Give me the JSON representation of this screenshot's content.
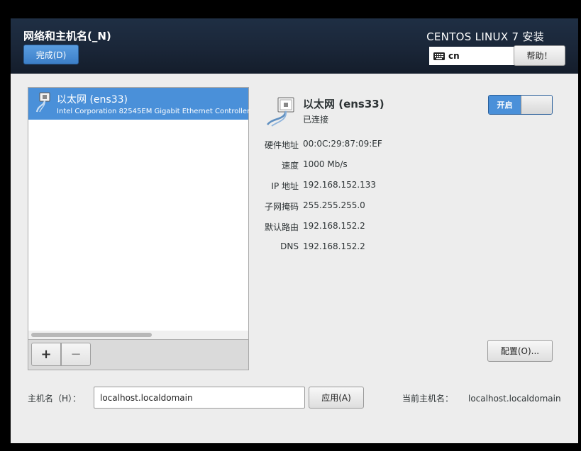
{
  "header": {
    "page_title": "网络和主机名(_N)",
    "done_label": "完成(D)",
    "product_title": "CENTOS LINUX 7 安装",
    "keyboard_layout": "cn",
    "help_label": "帮助！"
  },
  "connections": {
    "items": [
      {
        "name": "以太网 (ens33)",
        "description": "Intel Corporation 82545EM Gigabit Ethernet Controller"
      }
    ],
    "add_label": "+",
    "remove_label": "−"
  },
  "details": {
    "name": "以太网 (ens33)",
    "status": "已连接",
    "toggle_label": "开启",
    "properties": [
      {
        "label": "硬件地址",
        "value": "00:0C:29:87:09:EF"
      },
      {
        "label": "速度",
        "value": "1000 Mb/s"
      },
      {
        "label": "IP 地址",
        "value": "192.168.152.133"
      },
      {
        "label": "子网掩码",
        "value": "255.255.255.0"
      },
      {
        "label": "默认路由",
        "value": "192.168.152.2"
      },
      {
        "label": "DNS",
        "value": "192.168.152.2"
      }
    ],
    "config_label": "配置(O)..."
  },
  "hostname": {
    "label": "主机名（H）：",
    "value": "localhost.localdomain",
    "apply_label": "应用(A)",
    "current_label": "当前主机名：",
    "current_value": "localhost.localdomain"
  },
  "colors": {
    "accent": "#4a90d9",
    "header_bg": "#1a2638",
    "window_bg": "#ededed"
  },
  "icons": {
    "keyboard": "keyboard-icon",
    "ethernet": "ethernet-cable-icon"
  }
}
